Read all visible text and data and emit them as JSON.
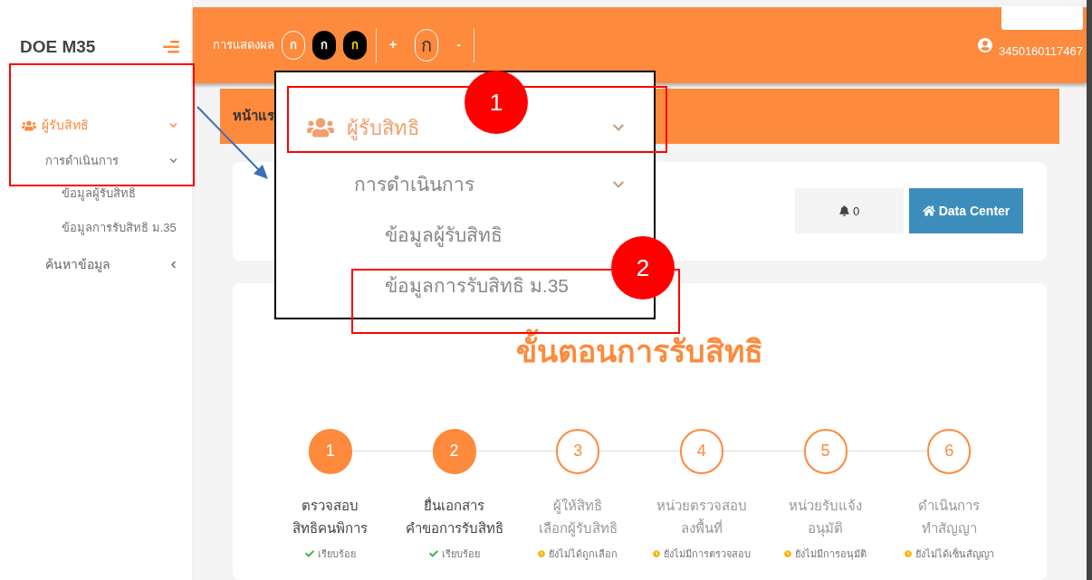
{
  "sidebar": {
    "logo": "DOE M35",
    "menu": [
      {
        "label": "ผู้รับสิทธิ",
        "selected": true,
        "expanded": true,
        "children": [
          {
            "label": "การดำเนินการ",
            "expanded": true,
            "children": [
              {
                "label": "ข้อมูลผู้รับสิทธิ"
              },
              {
                "label": "ข้อมูลการรับสิทธิ ม.35"
              }
            ]
          }
        ]
      },
      {
        "label": "ค้นหาข้อมูล",
        "selected": false,
        "expanded": false
      }
    ]
  },
  "header": {
    "display_label": "การแสดงผล",
    "contrast_buttons": [
      {
        "label": "ก",
        "kind": "normal"
      },
      {
        "label": "ก",
        "kind": "dark"
      },
      {
        "label": "ก",
        "kind": "yellow"
      }
    ],
    "size_controls": [
      {
        "label": "+",
        "kind": "plus"
      },
      {
        "label": "ก",
        "kind": "reset"
      },
      {
        "label": "-",
        "kind": "minus"
      }
    ],
    "user": "3450160117467"
  },
  "breadcrumb": "หน้าแร",
  "toolbar": {
    "notifications": "0",
    "button": "Data Center"
  },
  "process": {
    "title": "ขั้นตอนการรับสิทธิ",
    "steps": [
      {
        "number": "1",
        "title": [
          "ตรวจสอบ",
          "สิทธิคนพิการ"
        ],
        "status": "เรียบร้อย",
        "done": true
      },
      {
        "number": "2",
        "title": [
          "ยื่นเอกสาร",
          "คำขอการรับสิทธิ"
        ],
        "status": "เรียบร้อย",
        "done": true
      },
      {
        "number": "3",
        "title": [
          "ผู้ให้สิทธิ",
          "เลือกผู้รับสิทธิ"
        ],
        "status": "ยังไม่ได้ถูกเลือก",
        "done": false
      },
      {
        "number": "4",
        "title": [
          "หน่วยตรวจสอบ",
          "ลงพื้นที่"
        ],
        "status": "ยังไม่มีการตรวจสอบ",
        "done": false
      },
      {
        "number": "5",
        "title": [
          "หน่วยรับแจ้ง",
          "อนุมัติ"
        ],
        "status": "ยังไม่มีการอนุมัติ",
        "done": false
      },
      {
        "number": "6",
        "title": [
          "ดำเนินการ",
          "ทำสัญญา"
        ],
        "status": "ยังไม่ได้เซ็นสัญญา",
        "done": false
      }
    ]
  },
  "callout": {
    "items": [
      {
        "label": "ผู้รับสิทธิ",
        "kind": "group",
        "expanded": true
      },
      {
        "label": "การดำเนินการ",
        "kind": "subgroup",
        "expanded": true
      },
      {
        "label": "ข้อมูลผู้รับสิทธิ",
        "kind": "link"
      },
      {
        "label": "ข้อมูลการรับสิทธิ ม.35",
        "kind": "link"
      }
    ]
  },
  "annotations": {
    "markers": [
      "1",
      "2"
    ]
  }
}
